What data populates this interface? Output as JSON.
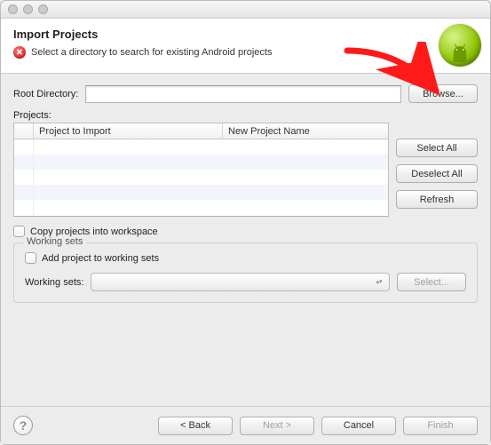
{
  "header": {
    "title": "Import Projects",
    "subtitle": "Select a directory to search for existing Android projects"
  },
  "root": {
    "label": "Root Directory:",
    "value": "",
    "browse": "Browse..."
  },
  "projects": {
    "label": "Projects:",
    "columns": {
      "col1": "Project to Import",
      "col2": "New Project Name"
    },
    "rows": [],
    "buttons": {
      "select_all": "Select All",
      "deselect_all": "Deselect All",
      "refresh": "Refresh"
    }
  },
  "copy_checkbox": "Copy projects into workspace",
  "working_sets": {
    "group_title": "Working sets",
    "add_label": "Add project to working sets",
    "combo_label": "Working sets:",
    "combo_value": "",
    "select_button": "Select..."
  },
  "footer": {
    "back": "< Back",
    "next": "Next >",
    "cancel": "Cancel",
    "finish": "Finish"
  }
}
